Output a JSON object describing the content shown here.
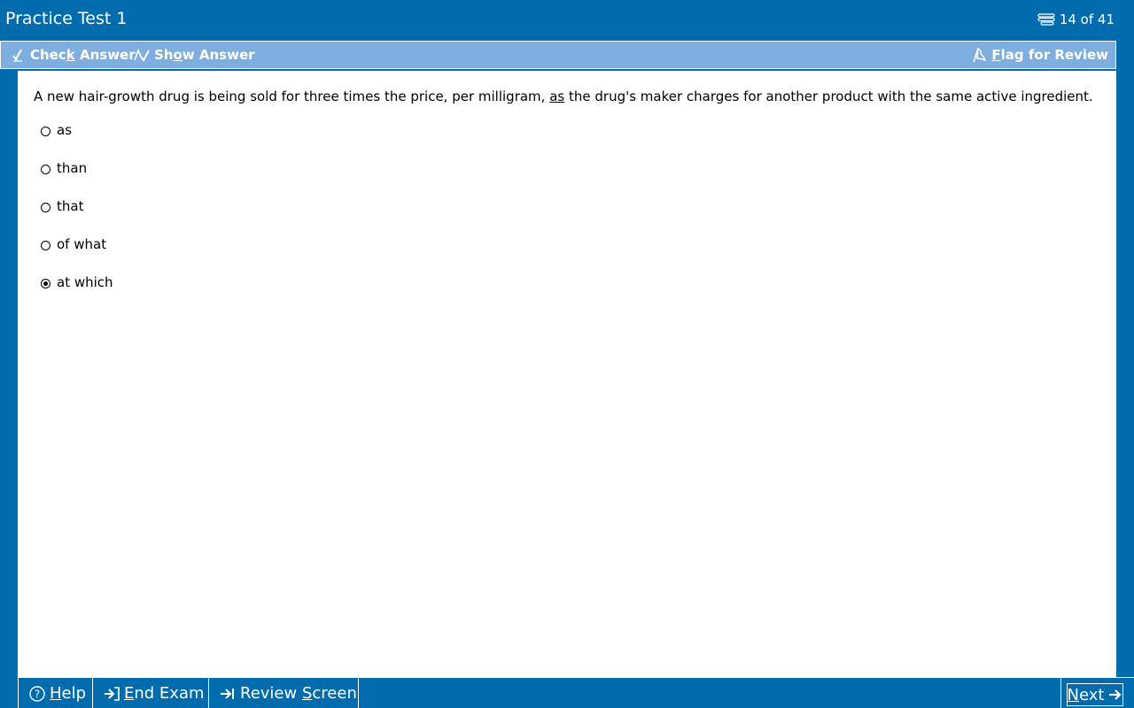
{
  "title": "Practice Test 1",
  "counter": "14 of 41",
  "toolbar": {
    "check_answer": {
      "before": "Chec",
      "key": "k",
      "after": " Answer"
    },
    "show_answer": {
      "before": "Sh",
      "key": "o",
      "after": "w Answer"
    },
    "flag_review": {
      "before": "",
      "key": "F",
      "after": "lag for Review"
    }
  },
  "question": {
    "before": "A new hair-growth drug is being sold for three times the price, per milligram, ",
    "underlined": "as",
    "after": " the drug's maker charges for another product with the same active ingredient."
  },
  "options": [
    {
      "label": "as",
      "selected": false
    },
    {
      "label": "than",
      "selected": false
    },
    {
      "label": "that",
      "selected": false
    },
    {
      "label": "of what",
      "selected": false
    },
    {
      "label": "at which",
      "selected": true
    }
  ],
  "bottom": {
    "help": {
      "before": "",
      "key": "H",
      "after": "elp"
    },
    "end_exam": {
      "before": "",
      "key": "E",
      "after": "nd Exam"
    },
    "review_screen": {
      "before": "Review ",
      "key": "S",
      "after": "creen"
    },
    "next": {
      "before": "",
      "key": "N",
      "after": "ext"
    }
  },
  "colors": {
    "frame": "#006bad",
    "toolbar": "#7eaee0",
    "content": "#ffffff"
  }
}
